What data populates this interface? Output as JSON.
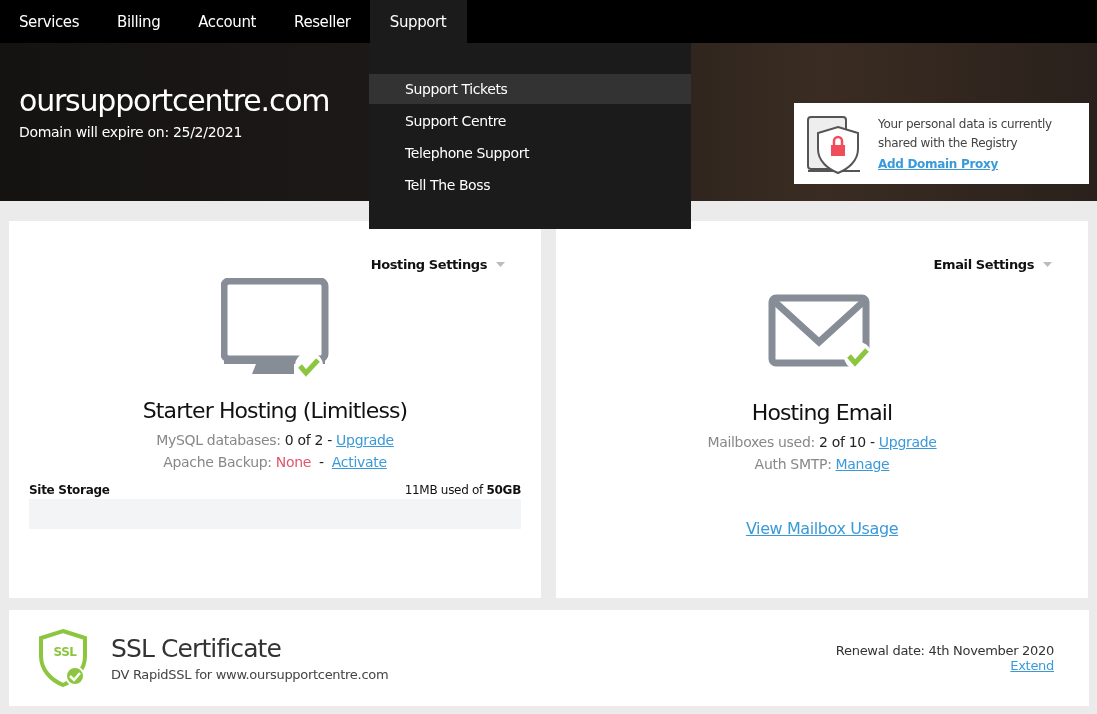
{
  "nav": [
    {
      "label": "Services",
      "selected": false
    },
    {
      "label": "Billing",
      "selected": false
    },
    {
      "label": "Account",
      "selected": false
    },
    {
      "label": "Reseller",
      "selected": false
    },
    {
      "label": "Support",
      "selected": true
    }
  ],
  "dropdown": [
    {
      "label": "Support Tickets",
      "selected": true
    },
    {
      "label": "Support Centre",
      "selected": false
    },
    {
      "label": "Telephone Support",
      "selected": false
    },
    {
      "label": "Tell The Boss",
      "selected": false
    }
  ],
  "domain": {
    "title": "oursupportcentre.com",
    "expiry": "Domain will expire on: 25/2/2021"
  },
  "privacy_notice": {
    "text": "Your personal data is currently shared with the Registry",
    "link": "Add Domain Proxy"
  },
  "cards": [
    {
      "kind": "hosting",
      "menu": "Hosting Settings",
      "title": "Starter Hosting (Limitless)",
      "lines": [
        {
          "label": "MySQL databases:",
          "value": "0 of 2 -",
          "alert": false,
          "link": "Upgrade"
        },
        {
          "label": "Apache Backup:",
          "value": "None",
          "alert": true,
          "separator": "-",
          "link": "Activate"
        }
      ],
      "storage": {
        "label": "Site Storage",
        "reading": "11MB used of **50GB**"
      }
    },
    {
      "kind": "email",
      "menu": "Email Settings",
      "title": "Hosting Email",
      "lines": [
        {
          "label": "Mailboxes used:",
          "value": "2 of 10 -",
          "alert": false,
          "link": "Upgrade"
        },
        {
          "label": "Auth SMTP:",
          "link": "Manage"
        }
      ],
      "footer_link": "View Mailbox Usage"
    }
  ],
  "ssl": {
    "badge": "SSL",
    "title": "SSL Certificate",
    "subtitle": "DV RapidSSL for www.oursupportcentre.com",
    "renewal": "Renewal date: 4th November 2020",
    "link": "Extend"
  }
}
